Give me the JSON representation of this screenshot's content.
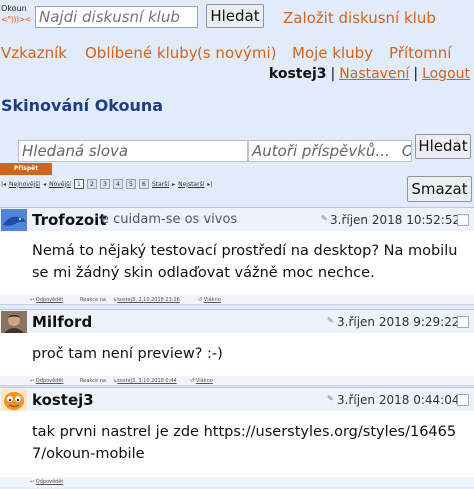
{
  "header": {
    "logo_title": "Okoun",
    "logo_sub": "<°)))><",
    "search_placeholder": "Najdi diskusní klub",
    "search_button": "Hledat",
    "found_club_link": "Založit diskusní klub"
  },
  "nav": {
    "items": [
      "Vzkazník",
      "Oblíbené kluby",
      "(s novými)",
      "Moje kluby",
      "Přítomní"
    ]
  },
  "user": {
    "username": "kostej3",
    "settings": "Nastavení",
    "logout": "Logout",
    "separator": "|"
  },
  "page": {
    "title": "Skinování Okouna"
  },
  "filter": {
    "words_placeholder": "Hledaná slova",
    "authors_placeholder": "Autoři příspěvků...",
    "authors_overflow": "Od",
    "search_button": "Hledat",
    "post_tab": "Přispět",
    "delete_button": "Smazat"
  },
  "pager": {
    "newest": "Nejnovější",
    "newer": "Novější",
    "pages": [
      "1",
      "2",
      "3",
      "4",
      "5",
      "6"
    ],
    "older": "Starší",
    "oldest": "Nejstarší"
  },
  "posts": [
    {
      "author": "Trofozoit",
      "club_note": "e cuidam-se os vivos",
      "date": "3.říjen 2018 10:52:52",
      "text": "Nemá to nějaký testovací prostředí na desktop? Na mobilu se mi žádný skin odlaďovat vážně moc nechce.",
      "reply": "Odpovědět",
      "reaction_label": "Reakce na",
      "reaction_ref": "kostej3, 2.10.2018 23:26",
      "thread": "Vlákno",
      "avatar_icon": "dolphin-avatar-icon",
      "avatar_color": "#2a63c7"
    },
    {
      "author": "Milford",
      "club_note": "",
      "date": "3.říjen 2018 9:29:22",
      "text": "proč tam není preview? :-)",
      "reply": "Odpovědět",
      "reaction_label": "Reakce na",
      "reaction_ref": "kostej3, 3.10.2018 0:44",
      "thread": "Vlákno",
      "avatar_icon": "portrait-avatar-icon",
      "avatar_color": "#6b5a48"
    },
    {
      "author": "kostej3",
      "club_note": "",
      "date": "3.říjen 2018 0:44:04",
      "text": "tak prvni nastrel je zde https://userstyles.org/styles/164657/okoun-mobile",
      "reply": "Odpovědět",
      "reaction_label": "",
      "reaction_ref": "",
      "thread": "",
      "avatar_icon": "garfield-avatar-icon",
      "avatar_color": "#f0932b"
    }
  ],
  "colors": {
    "accent_orange": "#d2641e",
    "title_blue": "#1b3d86",
    "page_bg": "#e2ebf9"
  }
}
